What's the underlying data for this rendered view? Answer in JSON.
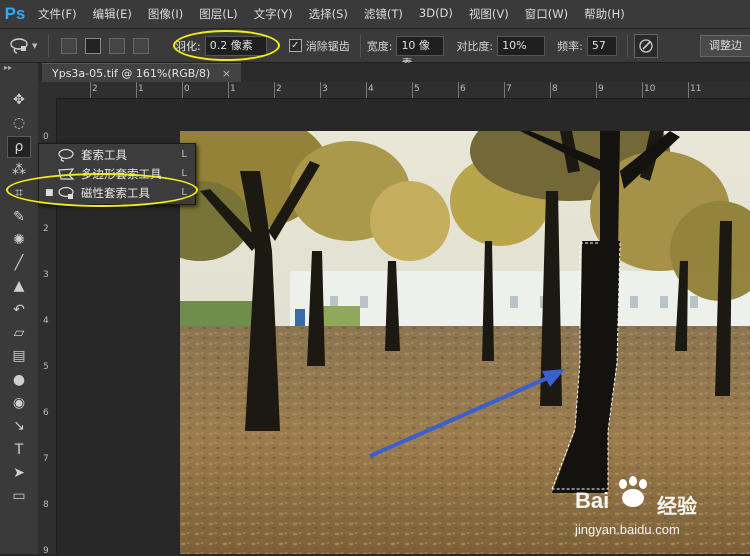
{
  "app": {
    "logo": "Ps"
  },
  "menu": [
    "文件(F)",
    "编辑(E)",
    "图像(I)",
    "图层(L)",
    "文字(Y)",
    "选择(S)",
    "滤镜(T)",
    "3D(D)",
    "视图(V)",
    "窗口(W)",
    "帮助(H)"
  ],
  "options": {
    "feather_label": "羽化:",
    "feather_value": "0.2 像素",
    "antialias_label": "消除锯齿",
    "antialias_checked": true,
    "width_label": "宽度:",
    "width_value": "10 像素",
    "contrast_label": "对比度:",
    "contrast_value": "10%",
    "frequency_label": "频率:",
    "frequency_value": "57",
    "refine_button": "调整边"
  },
  "document": {
    "tab_title": "Yps3a-05.tif @ 161%(RGB/8)",
    "close_glyph": "×"
  },
  "ruler": {
    "top_labels": [
      "2",
      "1",
      "0",
      "1",
      "2",
      "3",
      "4",
      "5",
      "6",
      "7",
      "8",
      "9",
      "10",
      "11"
    ],
    "left_labels": [
      "0",
      "1",
      "2",
      "3",
      "4",
      "5",
      "6",
      "7",
      "8",
      "9"
    ]
  },
  "flyout": {
    "items": [
      {
        "label": "套索工具",
        "key": "L",
        "icon": "lasso-icon",
        "selected": false
      },
      {
        "label": "多边形套索工具",
        "key": "L",
        "icon": "polygon-lasso-icon",
        "selected": false
      },
      {
        "label": "磁性套索工具",
        "key": "L",
        "icon": "magnetic-lasso-icon",
        "selected": true
      }
    ],
    "bullet": "■"
  },
  "tools": [
    "move-icon",
    "marquee-icon",
    "lasso-icon",
    "magic-wand-icon",
    "crop-icon",
    "eyedropper-icon",
    "healing-icon",
    "brush-icon",
    "stamp-icon",
    "history-brush-icon",
    "eraser-icon",
    "gradient-icon",
    "blur-icon",
    "dodge-icon",
    "pen-icon",
    "type-icon",
    "path-select-icon",
    "shape-icon"
  ],
  "watermark": {
    "brand": "Bai",
    "brand2": "经验",
    "url": "jingyan.baidu.com"
  },
  "colors": {
    "highlight": "#f4ec1a",
    "arrow": "#3a5fd0",
    "ps_blue": "#31a8ff"
  }
}
